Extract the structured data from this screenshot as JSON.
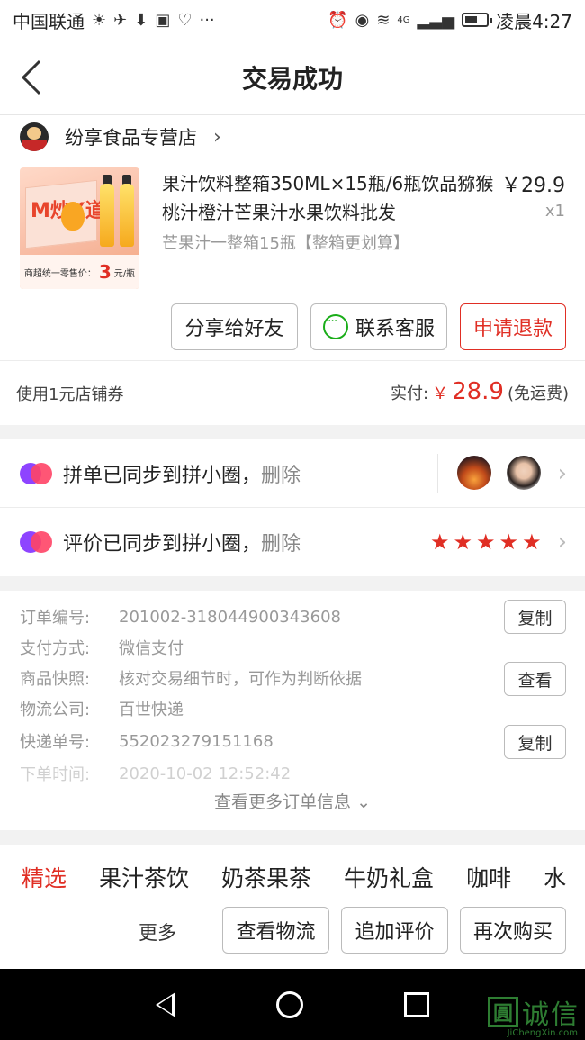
{
  "status_bar": {
    "carrier": "中国联通",
    "time": "凌晨4:27",
    "network": "4G",
    "battery_level": 0.6
  },
  "header": {
    "title": "交易成功"
  },
  "order_card": {
    "store_name": "纷享食品专营店",
    "product_title": "果汁饮料整箱350ML×15瓶/6瓶饮品猕猴桃汁橙汁芒果汁水果饮料批发",
    "price": "￥29.9",
    "quantity": "x1",
    "spec": "芒果汁一整箱15瓶【整箱更划算】",
    "product_image_text": {
      "brand": "M炒X道",
      "strip_prefix": "商超统一零售价：",
      "strip_value": "3",
      "strip_suffix": "元/瓶"
    },
    "buttons": {
      "share": "分享给好友",
      "service": "联系客服",
      "refund": "申请退款"
    },
    "coupon": "使用1元店铺券",
    "paid_label": "实付:",
    "paid_currency": "￥",
    "paid_amount": "28.9",
    "paid_note": "(免运费)"
  },
  "social": {
    "group_text": "拼单已同步到拼小圈，",
    "group_delete": "删除",
    "review_text": "评价已同步到拼小圈，",
    "review_delete": "删除",
    "review_stars": 5
  },
  "order_info": {
    "rows": [
      {
        "label": "订单编号:",
        "value": "201002-318044900343608",
        "action": "复制"
      },
      {
        "label": "支付方式:",
        "value": "微信支付"
      },
      {
        "label": "商品快照:",
        "value": "核对交易细节时，可作为判断依据",
        "action": "查看"
      },
      {
        "label": "物流公司:",
        "value": "百世快递"
      },
      {
        "label": "快递单号:",
        "value": "552023279151168",
        "action": "复制"
      },
      {
        "label": "下单时间:",
        "value": "2020-10-02 12:52:42"
      }
    ],
    "more": "查看更多订单信息"
  },
  "categories": {
    "items": [
      "精选",
      "果汁茶饮",
      "奶茶果茶",
      "牛奶礼盒",
      "咖啡",
      "水"
    ],
    "active": "精选"
  },
  "action_bar": {
    "more": "更多",
    "logistics": "查看物流",
    "review": "追加评价",
    "rebuy": "再次购买"
  },
  "watermark": {
    "text": "诚信",
    "logo": "圓",
    "sub": "JiChengXin.com"
  },
  "colors": {
    "accent": "#e02e24",
    "wechat_green": "#1aad19",
    "muted": "#999999"
  }
}
